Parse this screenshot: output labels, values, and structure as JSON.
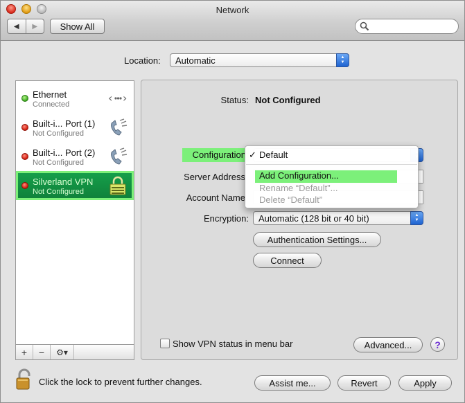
{
  "window": {
    "title": "Network"
  },
  "toolbar": {
    "back_glyph": "◀",
    "forward_glyph": "▶",
    "show_all_label": "Show All",
    "search_placeholder": ""
  },
  "location": {
    "label": "Location:",
    "value": "Automatic"
  },
  "services": [
    {
      "name": "Ethernet",
      "status": "Connected",
      "status_color": "#3aa81e",
      "icon": "ethernet-icon"
    },
    {
      "name": "Built-i... Port (1)",
      "status": "Not Configured",
      "status_color": "#d11a0c",
      "icon": "phone-modem-icon"
    },
    {
      "name": "Built-i... Port (2)",
      "status": "Not Configured",
      "status_color": "#d11a0c",
      "icon": "phone-modem-icon"
    },
    {
      "name": "Silverland VPN",
      "status": "Not Configured",
      "status_color": "#d11a0c",
      "icon": "vpn-lock-icon",
      "selected": true
    }
  ],
  "sidebar_toolbar": {
    "add": "+",
    "remove": "−",
    "gear": "⚙▾"
  },
  "detail": {
    "status_label": "Status:",
    "status_value": "Not Configured",
    "configuration_label": "Configuration",
    "server_address_label": "Server Address",
    "account_name_label": "Account Name",
    "encryption_label": "Encryption:",
    "encryption_value": "Automatic (128 bit or 40 bit)",
    "auth_settings_label": "Authentication Settings...",
    "connect_label": "Connect",
    "show_vpn_label": "Show VPN status in menu bar",
    "show_vpn_checked": false,
    "advanced_label": "Advanced...",
    "help_label": "?"
  },
  "config_menu": {
    "items": [
      {
        "label": "Default",
        "checked": true,
        "enabled": true
      },
      {
        "label": "Add Configuration...",
        "enabled": true,
        "highlighted": true
      },
      {
        "label": "Rename “Default”...",
        "enabled": false
      },
      {
        "label": "Delete “Default”",
        "enabled": false
      }
    ],
    "check_glyph": "✓"
  },
  "footer": {
    "lock_text": "Click the lock to prevent further changes.",
    "assist_label": "Assist me...",
    "revert_label": "Revert",
    "apply_label": "Apply"
  },
  "colors": {
    "highlight": "#7cf07a",
    "selected_row": "#128c40",
    "accent_blue": "#1e62d0"
  }
}
